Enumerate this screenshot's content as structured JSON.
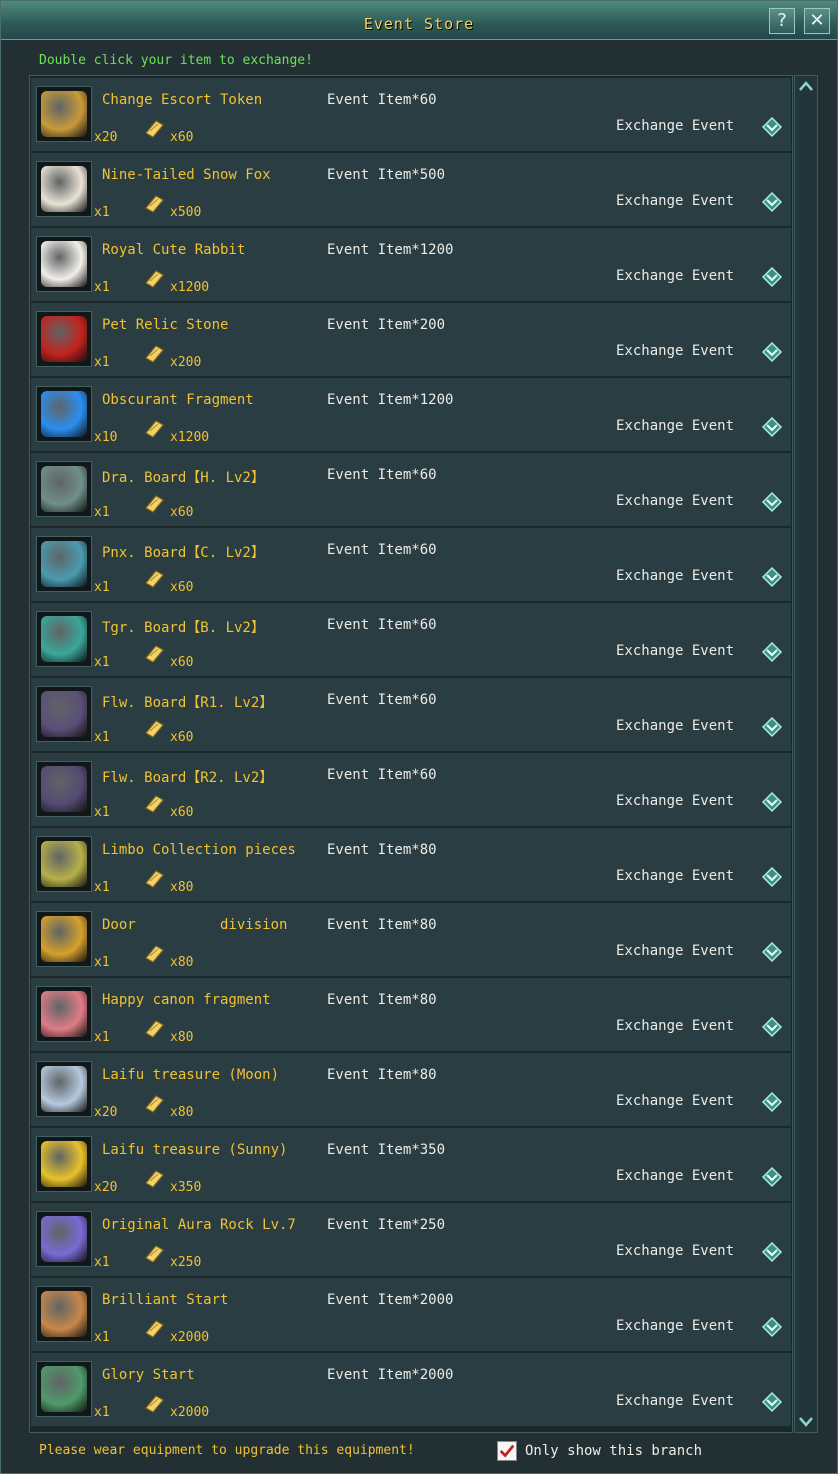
{
  "window": {
    "title": "Event Store",
    "help_label": "?",
    "close_label": "✕"
  },
  "hint": "Double click your item to exchange!",
  "exchange_label": "Exchange Event",
  "items": [
    {
      "name": "Change Escort Token",
      "qty": "x20",
      "cost": "Event Item*60",
      "price": "x60",
      "icon": "token-icon",
      "color": "#c89a3a"
    },
    {
      "name": "Nine-Tailed Snow Fox",
      "qty": "x1",
      "cost": "Event Item*500",
      "price": "x500",
      "icon": "snow-fox-icon",
      "color": "#e8e2d6"
    },
    {
      "name": "Royal Cute Rabbit",
      "qty": "x1",
      "cost": "Event Item*1200",
      "price": "x1200",
      "icon": "rabbit-icon",
      "color": "#f2efe9"
    },
    {
      "name": "Pet Relic Stone",
      "qty": "x1",
      "cost": "Event Item*200",
      "price": "x200",
      "icon": "relic-stone-icon",
      "color": "#c3221d"
    },
    {
      "name": "Obscurant Fragment",
      "qty": "x10",
      "cost": "Event Item*1200",
      "price": "x1200",
      "icon": "crystal-icon",
      "color": "#2a8ef2"
    },
    {
      "name": "Dra. Board【H. Lv2】",
      "qty": "x1",
      "cost": "Event Item*60",
      "price": "x60",
      "icon": "dragon-board-icon",
      "color": "#6f8f8a"
    },
    {
      "name": "Pnx. Board【C. Lv2】",
      "qty": "x1",
      "cost": "Event Item*60",
      "price": "x60",
      "icon": "phoenix-board-icon",
      "color": "#4a9bb0"
    },
    {
      "name": "Tgr. Board【B. Lv2】",
      "qty": "x1",
      "cost": "Event Item*60",
      "price": "x60",
      "icon": "tiger-board-icon",
      "color": "#3aa79a"
    },
    {
      "name": "Flw. Board【R1. Lv2】",
      "qty": "x1",
      "cost": "Event Item*60",
      "price": "x60",
      "icon": "flower-board-icon",
      "color": "#5b4f78"
    },
    {
      "name": "Flw. Board【R2. Lv2】",
      "qty": "x1",
      "cost": "Event Item*60",
      "price": "x60",
      "icon": "flower-board-icon",
      "color": "#554a72"
    },
    {
      "name": "Limbo Collection pieces",
      "qty": "x1",
      "cost": "Event Item*80",
      "price": "x80",
      "icon": "collection-pieces-icon",
      "color": "#b7b04a"
    },
    {
      "name": "Door          division",
      "qty": "x1",
      "cost": "Event Item*80",
      "price": "x80",
      "icon": "scroll-icon",
      "color": "#d6a02c"
    },
    {
      "name": "Happy canon fragment",
      "qty": "x1",
      "cost": "Event Item*80",
      "price": "x80",
      "icon": "fragment-icon",
      "color": "#e07c86"
    },
    {
      "name": "Laifu treasure (Moon)",
      "qty": "x20",
      "cost": "Event Item*80",
      "price": "x80",
      "icon": "moon-treasure-icon",
      "color": "#b6c9de"
    },
    {
      "name": "Laifu treasure (Sunny)",
      "qty": "x20",
      "cost": "Event Item*350",
      "price": "x350",
      "icon": "sun-treasure-icon",
      "color": "#e8c22a"
    },
    {
      "name": "Original Aura Rock Lv.7",
      "qty": "x1",
      "cost": "Event Item*250",
      "price": "x250",
      "icon": "aura-rock-icon",
      "color": "#7a6ad6"
    },
    {
      "name": "Brilliant Start",
      "qty": "x1",
      "cost": "Event Item*2000",
      "price": "x2000",
      "icon": "ring-icon",
      "color": "#c9874a"
    },
    {
      "name": "Glory Start",
      "qty": "x1",
      "cost": "Event Item*2000",
      "price": "x2000",
      "icon": "ring-icon",
      "color": "#4f9a6a"
    }
  ],
  "footer": {
    "notice": "Please wear equipment to upgrade this equipment!",
    "checkbox_label": "Only show this branch",
    "checkbox_checked": true
  }
}
